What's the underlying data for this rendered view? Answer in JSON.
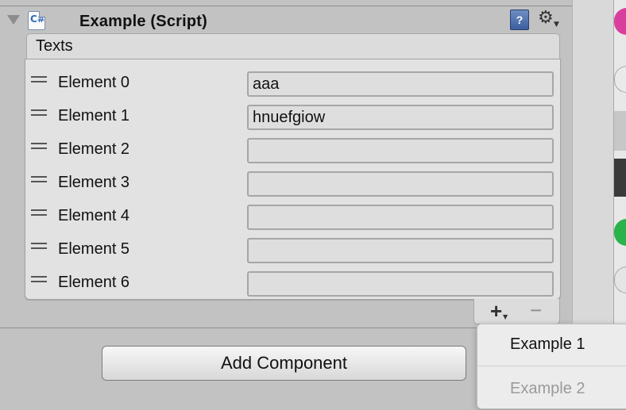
{
  "component": {
    "title": "Example (Script)",
    "help_icon": "help-book-icon",
    "settings_icon": "gear-icon"
  },
  "list": {
    "header": "Texts",
    "rows": [
      {
        "label": "Element 0",
        "value": "aaa"
      },
      {
        "label": "Element 1",
        "value": "hnuefgiow"
      },
      {
        "label": "Element 2",
        "value": ""
      },
      {
        "label": "Element 3",
        "value": ""
      },
      {
        "label": "Element 4",
        "value": ""
      },
      {
        "label": "Element 5",
        "value": ""
      },
      {
        "label": "Element 6",
        "value": ""
      }
    ],
    "add_glyph": "+",
    "remove_glyph": "−"
  },
  "add_component_label": "Add Component",
  "popup_menu": {
    "items": [
      {
        "label": "Example 1",
        "enabled": true
      },
      {
        "label": "Example 2",
        "enabled": false
      }
    ]
  },
  "colors": {
    "panel_bg": "#c2c2c2",
    "list_bg": "#e2e2e2",
    "disabled_text": "#9a9a9a"
  }
}
